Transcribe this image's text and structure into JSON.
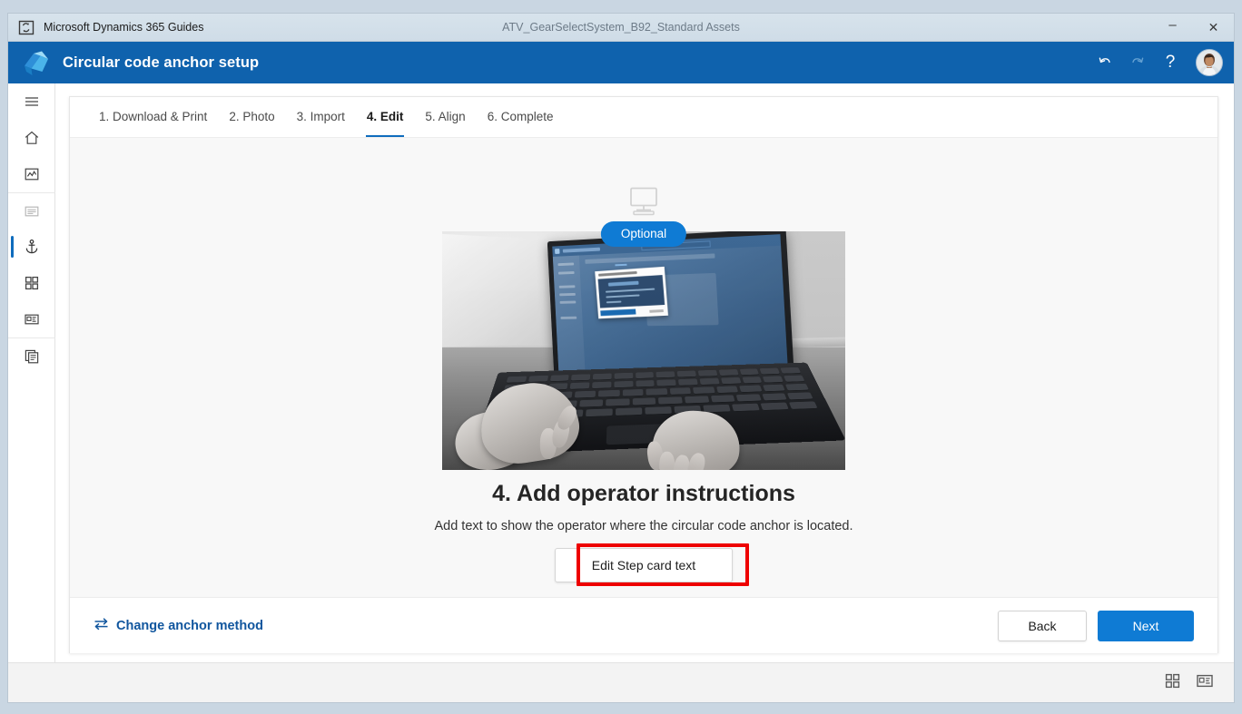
{
  "window": {
    "app_icon": "app-window-icon",
    "app_name": "Microsoft Dynamics 365 Guides",
    "document_title": "ATV_GearSelectSystem_B92_Standard Assets",
    "minimize_label": "–",
    "close_label": "✕"
  },
  "header": {
    "logo": "dynamics-guides-logo",
    "title": "Circular code anchor setup",
    "actions": [
      {
        "name": "undo-icon",
        "label": "Undo",
        "state": "enabled"
      },
      {
        "name": "redo-icon",
        "label": "Redo",
        "state": "disabled"
      },
      {
        "name": "help-icon",
        "label": "?"
      }
    ],
    "avatar": "user-avatar"
  },
  "sidebar": {
    "items": [
      {
        "name": "menu-icon",
        "label": "Menu",
        "state": "normal"
      },
      {
        "name": "home-icon",
        "label": "Home",
        "state": "normal"
      },
      {
        "name": "analytics-icon",
        "label": "Analytics",
        "state": "normal"
      },
      {
        "name": "step-card-icon",
        "label": "Step card",
        "state": "dim"
      },
      {
        "name": "anchor-icon",
        "label": "Anchor",
        "state": "active"
      },
      {
        "name": "grid-icon",
        "label": "Steps grid",
        "state": "normal"
      },
      {
        "name": "media-card-icon",
        "label": "Media card",
        "state": "normal"
      },
      {
        "name": "duplicate-icon",
        "label": "Copy",
        "state": "normal"
      }
    ],
    "bottom": {
      "name": "info-icon",
      "label": "Info"
    }
  },
  "tabs": [
    {
      "label": "1. Download & Print",
      "active": false
    },
    {
      "label": "2. Photo",
      "active": false
    },
    {
      "label": "3. Import",
      "active": false
    },
    {
      "label": "4. Edit",
      "active": true
    },
    {
      "label": "5. Align",
      "active": false
    },
    {
      "label": "6. Complete",
      "active": false
    }
  ],
  "main": {
    "badge": "Optional",
    "monitor_icon": "desktop-monitor-icon",
    "illustration": {
      "name": "laptop-typing-photo",
      "description": "Person typing on a laptop showing the Guides PC app with an anchoring instructions dialog"
    },
    "headline": "4. Add operator instructions",
    "subtext": "Add text to show the operator where the circular code anchor is located.",
    "edit_button": "Edit Step card text",
    "highlight_color": "#ee0000"
  },
  "footer": {
    "change_method_icon": "swap-arrows-icon",
    "change_method_label": "Change anchor method",
    "back_label": "Back",
    "next_label": "Next"
  },
  "statusbar": {
    "icons": [
      {
        "name": "grid-view-icon",
        "label": "Grid view"
      },
      {
        "name": "card-view-icon",
        "label": "Card view"
      }
    ]
  },
  "colors": {
    "header_blue": "#0f62ad",
    "accent_blue": "#0f7bd4",
    "link_blue": "#11569e",
    "highlight_red": "#ee0000"
  }
}
